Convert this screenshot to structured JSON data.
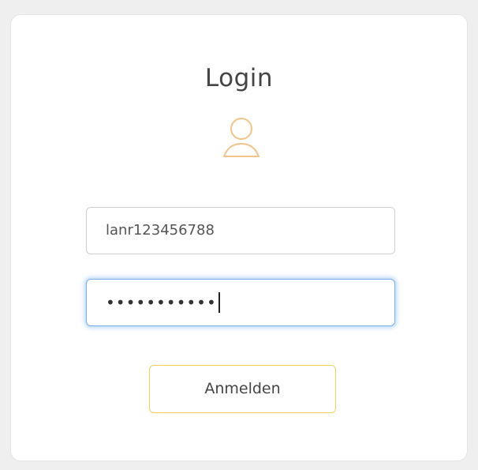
{
  "login": {
    "title": "Login",
    "username_value": "lanr123456788",
    "password_mask": "•••••••••••",
    "submit_label": "Anmelden"
  },
  "colors": {
    "icon_outline": "#f2c48b",
    "focus_border": "#7eaee6",
    "button_border": "#f1d15e"
  },
  "icons": {
    "user": "user-outline-icon"
  }
}
